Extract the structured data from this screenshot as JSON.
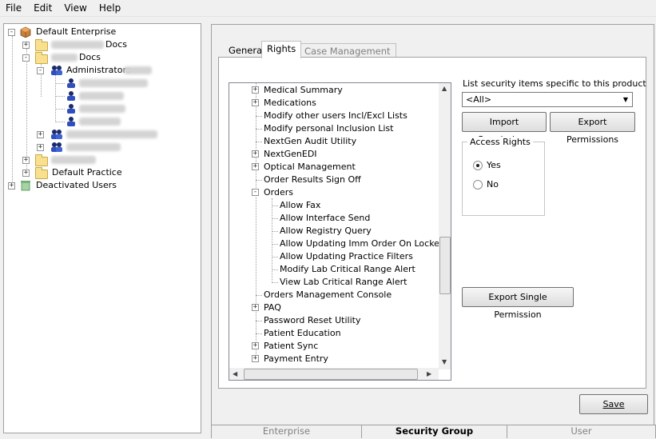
{
  "menu": [
    "File",
    "Edit",
    "View",
    "Help"
  ],
  "left_tree": {
    "root": "Default Enterprise",
    "docs_a": "Docs",
    "docs_b": "Docs",
    "administrators": "Administrators",
    "default_practice": "Default Practice",
    "deactivated_users": "Deactivated Users"
  },
  "tabs": {
    "general": "General",
    "rights": "Rights",
    "case_management": "Case Management"
  },
  "rights_tree": [
    {
      "label": "Medical Summary",
      "expander": "+",
      "level": 0
    },
    {
      "label": "Medications",
      "expander": "+",
      "level": 0
    },
    {
      "label": "Modify other users Incl/Excl Lists",
      "expander": "",
      "level": 0
    },
    {
      "label": "Modify personal Inclusion List",
      "expander": "",
      "level": 0
    },
    {
      "label": "NextGen Audit Utility",
      "expander": "",
      "level": 0
    },
    {
      "label": "NextGenEDI",
      "expander": "+",
      "level": 0
    },
    {
      "label": "Optical Management",
      "expander": "+",
      "level": 0
    },
    {
      "label": "Order Results Sign Off",
      "expander": "",
      "level": 0
    },
    {
      "label": "Orders",
      "expander": "-",
      "level": 0
    },
    {
      "label": "Allow Fax",
      "expander": "",
      "level": 1
    },
    {
      "label": "Allow Interface Send",
      "expander": "",
      "level": 1
    },
    {
      "label": "Allow Registry Query",
      "expander": "",
      "level": 1
    },
    {
      "label": "Allow Updating Imm Order On Locked Enc",
      "expander": "",
      "level": 1
    },
    {
      "label": "Allow Updating Practice Filters",
      "expander": "",
      "level": 1
    },
    {
      "label": "Modify Lab Critical Range Alert",
      "expander": "",
      "level": 1
    },
    {
      "label": "View Lab Critical Range Alert",
      "expander": "",
      "level": 1
    },
    {
      "label": "Orders Management Console",
      "expander": "",
      "level": 0
    },
    {
      "label": "PAQ",
      "expander": "+",
      "level": 0
    },
    {
      "label": "Password Reset Utility",
      "expander": "",
      "level": 0
    },
    {
      "label": "Patient Education",
      "expander": "",
      "level": 0
    },
    {
      "label": "Patient Sync",
      "expander": "+",
      "level": 0
    },
    {
      "label": "Payment Entry",
      "expander": "+",
      "level": 0
    }
  ],
  "right_panel": {
    "list_label": "List security items specific to this product",
    "product_value": "<All>",
    "import_btn": "Import Permissions",
    "export_btn": "Export Permissions",
    "access_rights": "Access Rights",
    "yes": "Yes",
    "no": "No",
    "access_value": "Yes",
    "export_single": "Export Single Permission"
  },
  "save_btn": "Save",
  "bottom_tabs": [
    "Enterprise",
    "Security Group",
    "User"
  ],
  "colors": {
    "panel_bg": "#f0f0f0",
    "white": "#ffffff",
    "border": "#a0a0a0"
  }
}
